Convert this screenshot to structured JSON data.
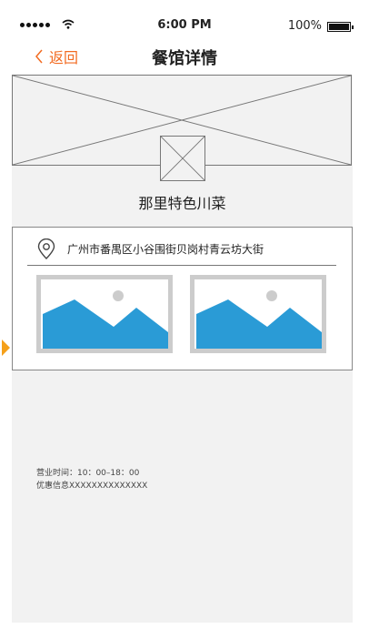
{
  "status_bar": {
    "time": "6:00 PM",
    "battery": "100%"
  },
  "nav": {
    "back_label": "返回",
    "title": "餐馆详情"
  },
  "restaurant": {
    "name": "那里特色川菜",
    "address": "广州市番禺区小谷围街贝岗村青云坊大街",
    "business_hours": "营业时间：10：00–18：00",
    "discount": "优惠信息XXXXXXXXXXXXXX"
  },
  "colors": {
    "accent": "#f26b21",
    "indicator": "#f5a01a",
    "photo_fill": "#2a9bd6",
    "panel_bg": "#f2f2f2"
  },
  "icons": [
    "signal-dots-icon",
    "wifi-icon",
    "battery-icon",
    "chevron-left-icon",
    "location-pin-icon",
    "image-placeholder-icon"
  ]
}
